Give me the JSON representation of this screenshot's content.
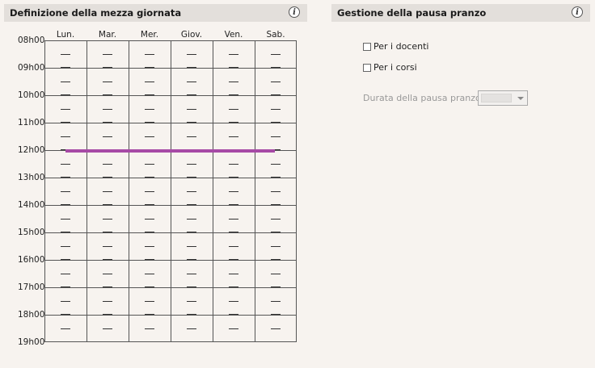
{
  "left_panel": {
    "title": "Definizione della mezza giornata",
    "days": [
      "Lun.",
      "Mar.",
      "Mer.",
      "Giov.",
      "Ven.",
      "Sab."
    ],
    "hours": [
      "08h00",
      "09h00",
      "10h00",
      "11h00",
      "12h00",
      "13h00",
      "14h00",
      "15h00",
      "16h00",
      "17h00",
      "18h00",
      "19h00"
    ],
    "slot_symbol": "—",
    "midday_marker_hour": "12h00",
    "midday_marker_color": "#a74aa6"
  },
  "right_panel": {
    "title": "Gestione della pausa pranzo",
    "checkboxes": [
      {
        "label": "Per i docenti",
        "checked": false
      },
      {
        "label": "Per i corsi",
        "checked": false
      }
    ],
    "duration_label": "Durata della pausa pranzo",
    "duration_value": ""
  },
  "icons": {
    "info": "info-icon",
    "dropdown_arrow": "chevron-down-icon"
  },
  "info_glyph": "i"
}
